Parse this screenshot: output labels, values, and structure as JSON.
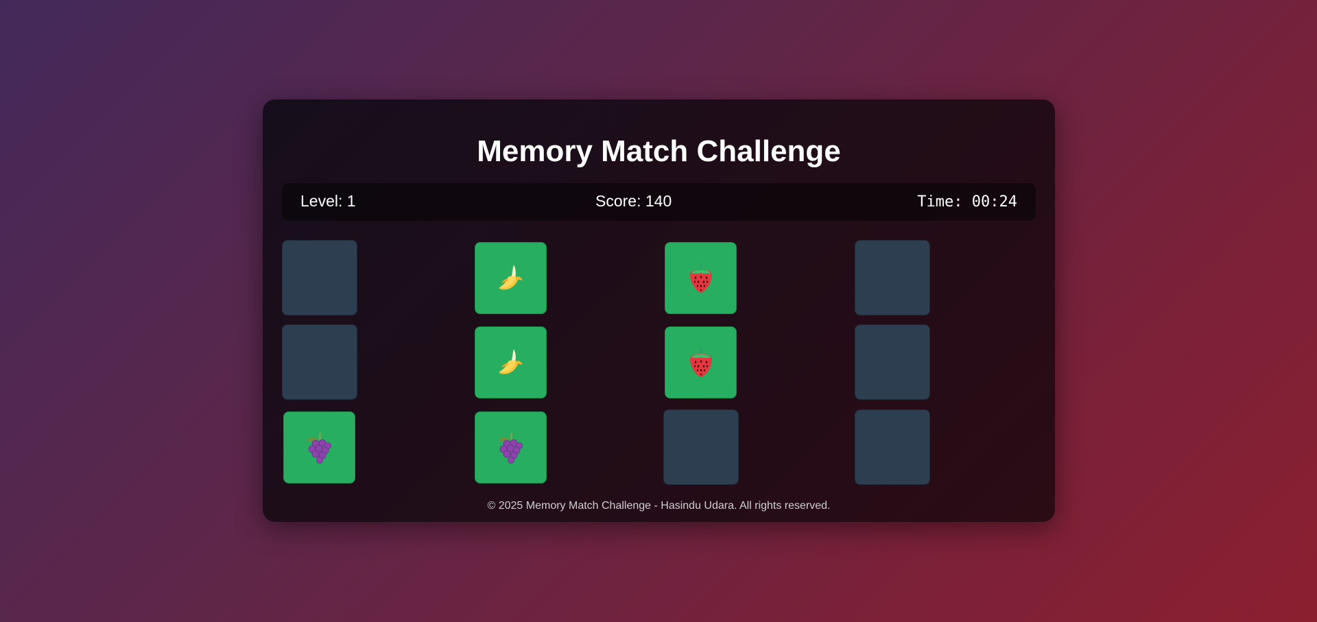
{
  "title": "Memory Match Challenge",
  "stats": {
    "level": "Level: 1",
    "score": "Score: 140",
    "time": "Time: 00:24"
  },
  "cards": [
    {
      "row": 1,
      "col": 1,
      "state": "hidden"
    },
    {
      "row": 1,
      "col": 2,
      "state": "revealed",
      "fruit": "banana"
    },
    {
      "row": 1,
      "col": 3,
      "state": "revealed",
      "fruit": "strawberry"
    },
    {
      "row": 1,
      "col": 4,
      "state": "hidden"
    },
    {
      "row": 2,
      "col": 1,
      "state": "hidden"
    },
    {
      "row": 2,
      "col": 2,
      "state": "revealed",
      "fruit": "banana"
    },
    {
      "row": 2,
      "col": 3,
      "state": "revealed",
      "fruit": "strawberry"
    },
    {
      "row": 2,
      "col": 4,
      "state": "hidden"
    },
    {
      "row": 3,
      "col": 1,
      "state": "revealed",
      "fruit": "grapes"
    },
    {
      "row": 3,
      "col": 2,
      "state": "revealed",
      "fruit": "grapes"
    },
    {
      "row": 3,
      "col": 3,
      "state": "hidden"
    },
    {
      "row": 3,
      "col": 4,
      "state": "hidden"
    }
  ],
  "footer": "© 2025 Memory Match Challenge - Hasindu Udara. All rights reserved.",
  "colors": {
    "card_back": "#2c3e50",
    "card_matched": "#27ae60"
  }
}
